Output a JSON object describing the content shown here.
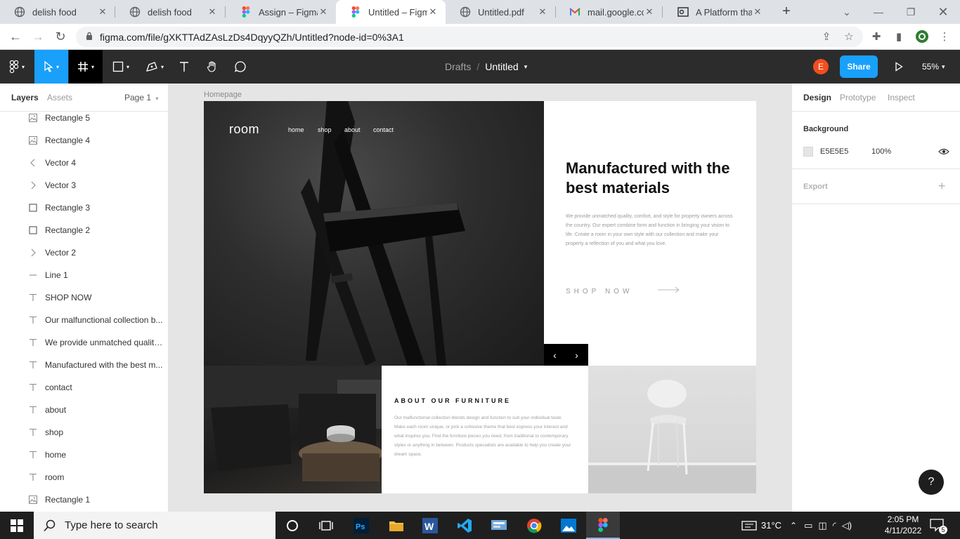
{
  "browser": {
    "tabs": [
      {
        "title": "delish food",
        "icon": "globe-icon",
        "active": false
      },
      {
        "title": "delish food",
        "icon": "globe-icon",
        "active": false
      },
      {
        "title": "Assign – Figma",
        "icon": "figma-icon",
        "active": false
      },
      {
        "title": "Untitled – Figma",
        "icon": "figma-icon",
        "active": true
      },
      {
        "title": "Untitled.pdf",
        "icon": "globe-icon",
        "active": false
      },
      {
        "title": "mail.google.com",
        "icon": "gmail-icon",
        "active": false
      },
      {
        "title": "A Platform that t",
        "icon": "outlook-icon",
        "active": false
      }
    ],
    "url": "figma.com/file/gXKTTAdZAsLzDs4DqyyQZh/Untitled?node-id=0%3A1"
  },
  "toolbar": {
    "breadcrumb_drafts": "Drafts",
    "breadcrumb_sep": "/",
    "file_name": "Untitled",
    "avatar_initial": "E",
    "share_label": "Share",
    "zoom": "55%"
  },
  "left_panel": {
    "tab_layers": "Layers",
    "tab_assets": "Assets",
    "page": "Page 1",
    "layers": [
      {
        "name": "Rectangle 5",
        "icon": "image-icon"
      },
      {
        "name": "Rectangle 4",
        "icon": "image-icon"
      },
      {
        "name": "Vector 4",
        "icon": "chevron-left-icon"
      },
      {
        "name": "Vector 3",
        "icon": "chevron-right-icon"
      },
      {
        "name": "Rectangle 3",
        "icon": "rectangle-icon"
      },
      {
        "name": "Rectangle 2",
        "icon": "rectangle-icon"
      },
      {
        "name": "Vector 2",
        "icon": "chevron-right-icon"
      },
      {
        "name": "Line 1",
        "icon": "line-icon"
      },
      {
        "name": "SHOP NOW",
        "icon": "text-icon"
      },
      {
        "name": "Our malfunctional collection b...",
        "icon": "text-icon"
      },
      {
        "name": "We provide unmatched quality...",
        "icon": "text-icon"
      },
      {
        "name": "Manufactured with the best m...",
        "icon": "text-icon"
      },
      {
        "name": "contact",
        "icon": "text-icon"
      },
      {
        "name": "about",
        "icon": "text-icon"
      },
      {
        "name": "shop",
        "icon": "text-icon"
      },
      {
        "name": "home",
        "icon": "text-icon"
      },
      {
        "name": "room",
        "icon": "text-icon"
      },
      {
        "name": "Rectangle 1",
        "icon": "image-icon"
      }
    ]
  },
  "canvas": {
    "frame_label": "Homepage",
    "logo": "room",
    "nav": [
      "home",
      "shop",
      "about",
      "contact"
    ],
    "heading": "Manufactured with the best materials",
    "body": "We provide unmatched quality, comfort, and style for property owners across the country. Our expert combine form and function in bringing your vision to life. Create a room in your own style with our collection and make your property a reflection of you and what you love.",
    "cta": "SHOP NOW",
    "about_title": "ABOUT OUR FURNITURE",
    "about_body": "Our malfunctional collection blends design and function to suit your individual taste. Make each room unique, or pick a cohesive theme that best express your interest and what inspires you. Find the furniture pieces you need, from traditional to contemporary styles or anything in between. Products specialists are available to help you create your dream space."
  },
  "right_panel": {
    "tab_design": "Design",
    "tab_prototype": "Prototype",
    "tab_inspect": "Inspect",
    "background_title": "Background",
    "bg_hex": "E5E5E5",
    "bg_opacity": "100%",
    "export_title": "Export",
    "help": "?"
  },
  "taskbar": {
    "search_placeholder": "Type here to search",
    "temperature": "31°C",
    "time": "2:05 PM",
    "date": "4/11/2022",
    "notifications": "5"
  },
  "colors": {
    "figma_blue": "#18a0fb",
    "toolbar_bg": "#2c2c2c",
    "canvas_bg": "#e5e5e5",
    "avatar": "#f24e1e"
  }
}
